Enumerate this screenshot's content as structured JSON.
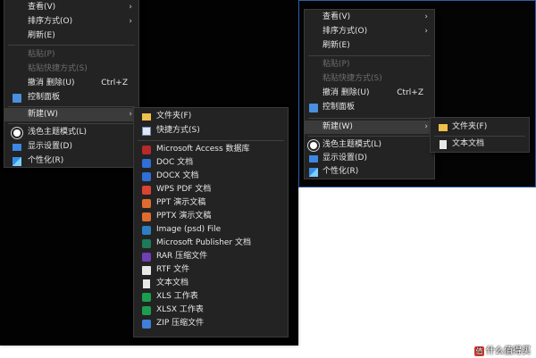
{
  "left_context_menu": {
    "items": [
      {
        "label": "查看(V)",
        "icon": "",
        "disabled": false,
        "submenu": true
      },
      {
        "label": "排序方式(O)",
        "icon": "",
        "disabled": false,
        "submenu": true
      },
      {
        "label": "刷新(E)",
        "icon": "",
        "disabled": false,
        "submenu": false
      },
      {
        "label": "粘贴(P)",
        "icon": "",
        "disabled": true,
        "submenu": false
      },
      {
        "label": "粘贴快捷方式(S)",
        "icon": "",
        "disabled": true,
        "submenu": false
      },
      {
        "label": "撤消 删除(U)",
        "shortcut": "Ctrl+Z",
        "icon": "",
        "disabled": false,
        "submenu": false
      },
      {
        "label": "控制面板",
        "icon": "control-panel-icon",
        "disabled": false,
        "submenu": false
      },
      {
        "label": "新建(W)",
        "icon": "",
        "disabled": false,
        "submenu": true,
        "highlighted": true
      },
      {
        "label": "浅色主题模式(L)",
        "icon": "sun-icon",
        "disabled": false,
        "submenu": false
      },
      {
        "label": "显示设置(D)",
        "icon": "monitor-icon",
        "disabled": false,
        "submenu": false
      },
      {
        "label": "个性化(R)",
        "icon": "personalize-icon",
        "disabled": false,
        "submenu": false
      }
    ]
  },
  "left_new_submenu": {
    "items": [
      {
        "label": "文件夹(F)",
        "icon": "folder-icon"
      },
      {
        "label": "快捷方式(S)",
        "icon": "shortcut-icon"
      },
      {
        "label": "Microsoft Access 数据库",
        "icon": "access-icon"
      },
      {
        "label": "DOC 文档",
        "icon": "wps-doc-icon"
      },
      {
        "label": "DOCX 文档",
        "icon": "wps-doc-icon"
      },
      {
        "label": "WPS PDF 文档",
        "icon": "wps-pdf-icon"
      },
      {
        "label": "PPT 演示文稿",
        "icon": "wps-ppt-icon"
      },
      {
        "label": "PPTX 演示文稿",
        "icon": "wps-ppt-icon"
      },
      {
        "label": "Image (psd) File",
        "icon": "image-icon"
      },
      {
        "label": "Microsoft Publisher 文档",
        "icon": "publisher-icon"
      },
      {
        "label": "RAR 压缩文件",
        "icon": "rar-icon"
      },
      {
        "label": "RTF 文件",
        "icon": "rtf-icon"
      },
      {
        "label": "文本文档",
        "icon": "text-document-icon"
      },
      {
        "label": "XLS 工作表",
        "icon": "xls-icon"
      },
      {
        "label": "XLSX 工作表",
        "icon": "xls-icon"
      },
      {
        "label": "ZIP 压缩文件",
        "icon": "zip-icon"
      }
    ]
  },
  "right_context_menu": {
    "items": [
      {
        "label": "查看(V)",
        "disabled": false,
        "submenu": true
      },
      {
        "label": "排序方式(O)",
        "disabled": false,
        "submenu": true
      },
      {
        "label": "刷新(E)",
        "disabled": false,
        "submenu": false
      },
      {
        "label": "粘贴(P)",
        "disabled": true,
        "submenu": false
      },
      {
        "label": "粘贴快捷方式(S)",
        "disabled": true,
        "submenu": false
      },
      {
        "label": "撤消 删除(U)",
        "shortcut": "Ctrl+Z",
        "disabled": false,
        "submenu": false
      },
      {
        "label": "控制面板",
        "icon": "control-panel-icon",
        "disabled": false,
        "submenu": false
      },
      {
        "label": "新建(W)",
        "disabled": false,
        "submenu": true,
        "highlighted": true
      },
      {
        "label": "浅色主题模式(L)",
        "icon": "sun-icon",
        "disabled": false,
        "submenu": false
      },
      {
        "label": "显示设置(D)",
        "icon": "monitor-icon",
        "disabled": false,
        "submenu": false
      },
      {
        "label": "个性化(R)",
        "icon": "personalize-icon",
        "disabled": false,
        "submenu": false
      }
    ]
  },
  "right_new_submenu": {
    "items": [
      {
        "label": "文件夹(F)",
        "icon": "folder-icon"
      },
      {
        "label": "文本文档",
        "icon": "text-document-icon"
      }
    ]
  },
  "watermark": {
    "badge": "值",
    "text": "什么值得买"
  },
  "colors": {
    "menu_bg": "#232323",
    "desktop_bg": "#020202",
    "accent_border": "#2b5fa8"
  }
}
